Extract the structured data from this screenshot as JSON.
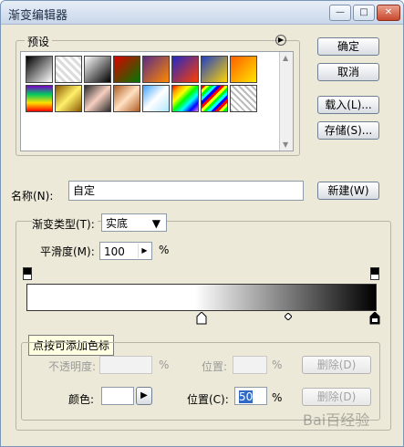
{
  "window": {
    "title": "渐变编辑器",
    "min": "—",
    "max": "□",
    "close": "✕"
  },
  "presets": {
    "label": "预设",
    "menu_icon": "arrow-icon"
  },
  "buttons": {
    "ok": "确定",
    "cancel": "取消",
    "load": "载入(L)...",
    "save": "存储(S)...",
    "new": "新建(W)",
    "delete1": "删除(D)",
    "delete2": "删除(D)"
  },
  "name": {
    "label": "名称(N):",
    "value": "自定"
  },
  "gradient": {
    "type_label": "渐变类型(T):",
    "type_value": "实底",
    "smooth_label": "平滑度(M):",
    "smooth_value": "100",
    "percent": "%"
  },
  "tooltip": "点按可添加色标",
  "stops": {
    "opacity_label": "不透明度:",
    "opacity_percent": "%",
    "position_label": "位置:",
    "position_percent": "%",
    "color_label": "颜色:",
    "color_position_label": "位置(C):",
    "color_position_value": "50",
    "color_percent": "%"
  },
  "watermark": "Bai百经验"
}
